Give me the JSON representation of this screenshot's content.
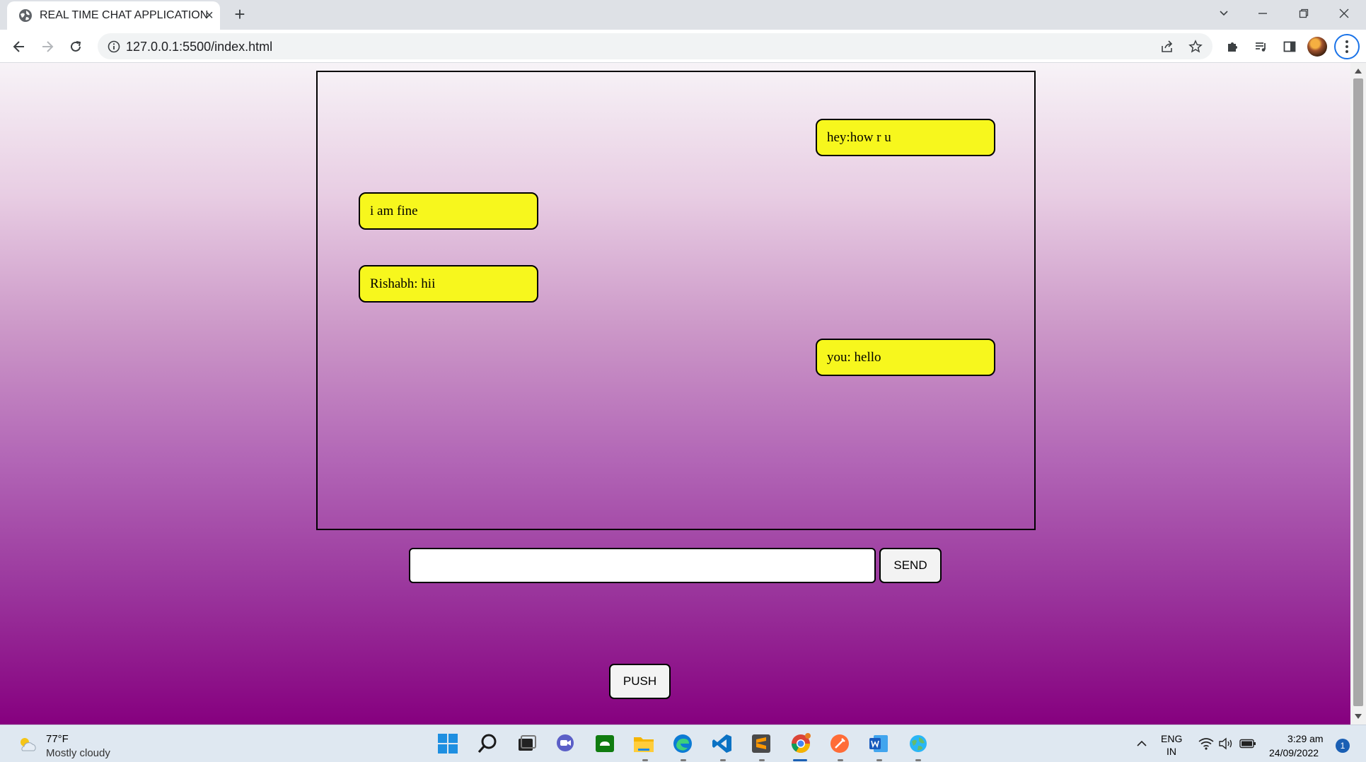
{
  "browser": {
    "tab_title": "REAL TIME CHAT APPLICATION",
    "url": "127.0.0.1:5500/index.html",
    "new_tab_symbol": "+",
    "close_tab_symbol": "×"
  },
  "chat": {
    "messages": [
      {
        "text": "hey:how r u",
        "side": "right"
      },
      {
        "text": "i am fine",
        "side": "left"
      },
      {
        "text": "Rishabh: hii",
        "side": "left"
      },
      {
        "text": "you: hello",
        "side": "right"
      }
    ],
    "input_value": "",
    "send_label": "SEND",
    "push_label": "PUSH"
  },
  "taskbar": {
    "weather_temp": "77°F",
    "weather_desc": "Mostly cloudy",
    "lang_line1": "ENG",
    "lang_line2": "IN",
    "time": "3:29 am",
    "date": "24/09/2022",
    "notification_count": "1",
    "apps": [
      "windows-start",
      "search",
      "task-view",
      "teams-chat",
      "xbox",
      "file-explorer",
      "edge",
      "vs-code",
      "sublime-text",
      "chrome",
      "postman",
      "word",
      "browser-globe"
    ]
  },
  "colors": {
    "bubble": "#f7f71d",
    "gradient_top": "#f7f3f7",
    "gradient_bottom": "#86007f"
  }
}
